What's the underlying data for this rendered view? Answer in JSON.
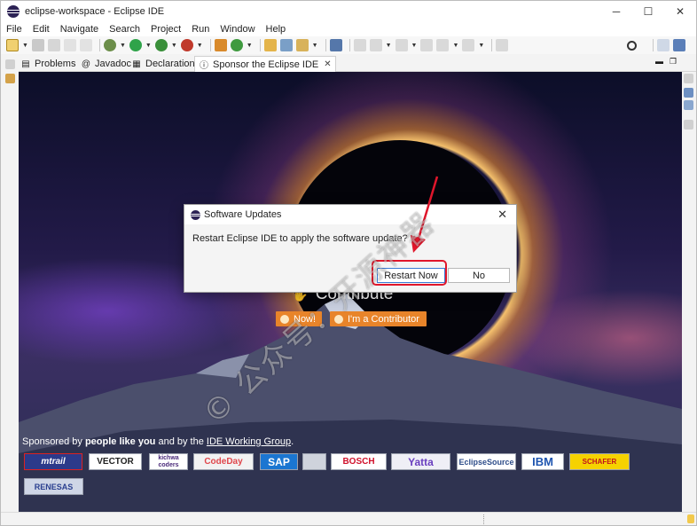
{
  "window": {
    "title": "eclipse-workspace - Eclipse IDE",
    "controls": {
      "minimize": "─",
      "maximize": "☐",
      "close": "✕"
    }
  },
  "menubar": [
    "File",
    "Edit",
    "Navigate",
    "Search",
    "Project",
    "Run",
    "Window",
    "Help"
  ],
  "tabs": [
    {
      "label": "Problems",
      "icon": "problems-icon",
      "glyph": "▤"
    },
    {
      "label": "Javadoc",
      "icon": "javadoc-icon",
      "glyph": "@"
    },
    {
      "label": "Declaration",
      "icon": "declaration-icon",
      "glyph": "▦"
    },
    {
      "label": "Sponsor the Eclipse IDE",
      "icon": "info-icon",
      "glyph": "ⓘ",
      "active": true,
      "close": "✕"
    }
  ],
  "sponsor_page": {
    "contribute_heading": "Contribute",
    "now_button": "Now!",
    "contributor_button": "I'm a Contributor",
    "sponsor_prefix": "Sponsored by ",
    "sponsor_people": "people like you",
    "sponsor_mid": " and by the ",
    "sponsor_link": "IDE Working Group",
    "sponsor_suffix": ".",
    "logos": [
      "mtrail",
      "VECTOR",
      "kichwa coders",
      "CodeDay",
      "SAP",
      "BOSCH",
      "Yatta",
      "EclipseSource",
      "IBM",
      "SCHAFER",
      "RENESAS"
    ]
  },
  "dialog": {
    "title": "Software Updates",
    "close": "✕",
    "message": "Restart Eclipse IDE to apply the software update?",
    "buttons": {
      "restart": "Restart Now",
      "no": "No"
    }
  },
  "watermark": "© 公众号：开源神器",
  "colors": {
    "accent_orange": "#e8842a",
    "highlight_red": "#e0162b",
    "eclipse_purple": "#2c2255"
  }
}
